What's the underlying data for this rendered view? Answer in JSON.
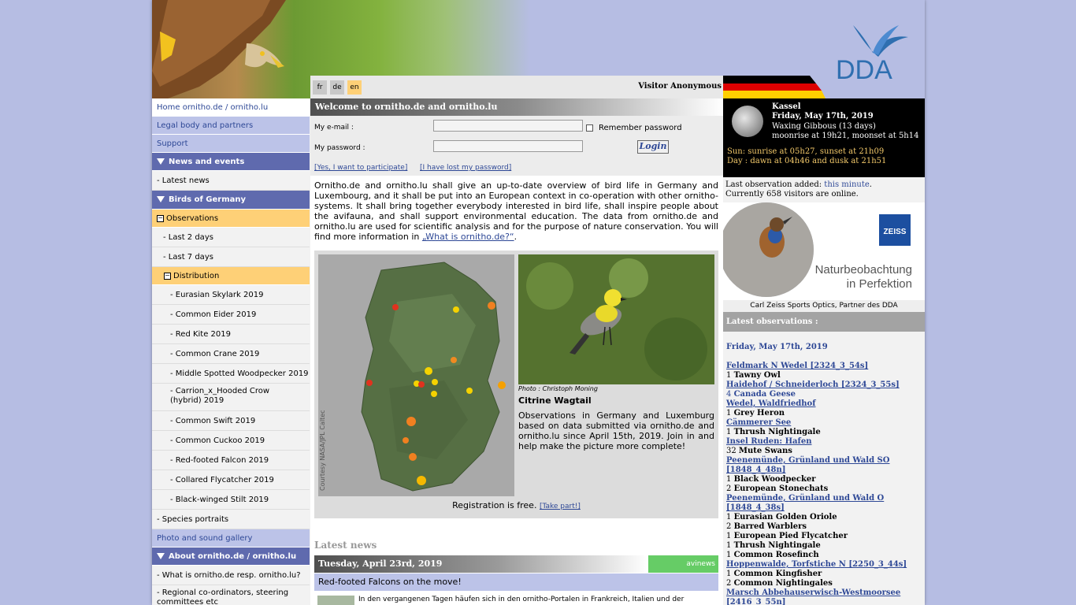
{
  "header": {
    "logo_text": "DDA",
    "languages": [
      {
        "code": "fr",
        "color": "#c8c8c8"
      },
      {
        "code": "de",
        "color": "#c8c8c8"
      },
      {
        "code": "en",
        "color": "#fed077"
      }
    ],
    "visitor": "Visitor Anonymous"
  },
  "sidebar": {
    "items": [
      {
        "label": "Home ornitho.de / ornitho.lu",
        "style": "white",
        "h": 23
      },
      {
        "label": "Legal body and partners",
        "style": "blue",
        "h": 23
      },
      {
        "label": "Support",
        "style": "blue",
        "h": 23
      },
      {
        "label": "News and events",
        "style": "head",
        "h": 23
      },
      {
        "label": "- Latest news",
        "style": "plain",
        "h": 25
      },
      {
        "label": "Birds of Germany",
        "style": "head",
        "h": 24
      },
      {
        "label": "Observations",
        "style": "orange",
        "h": 23
      },
      {
        "label": "- Last 2 days",
        "style": "plain",
        "h": 25
      },
      {
        "label": "- Last 7 days",
        "style": "plain",
        "h": 25
      },
      {
        "label": "Distribution",
        "style": "orange",
        "h": 23
      },
      {
        "label": "- Eurasian Skylark 2019",
        "style": "plain",
        "h": 25
      },
      {
        "label": "- Common Eider 2019",
        "style": "plain",
        "h": 25
      },
      {
        "label": "- Red Kite 2019",
        "style": "plain",
        "h": 25
      },
      {
        "label": "- Common Crane 2019",
        "style": "plain",
        "h": 25
      },
      {
        "label": "- Middle Spotted Woodpecker 2019",
        "style": "plain",
        "h": 25
      },
      {
        "label": "- Carrion_x_Hooded Crow (hybrid) 2019",
        "style": "plain",
        "h": 35
      },
      {
        "label": "- Common Swift 2019",
        "style": "plain",
        "h": 25
      },
      {
        "label": "- Common Cuckoo 2019",
        "style": "plain",
        "h": 25
      },
      {
        "label": "- Red-footed Falcon 2019",
        "style": "plain",
        "h": 25
      },
      {
        "label": "- Collared Flycatcher 2019",
        "style": "plain",
        "h": 25
      },
      {
        "label": "- Black-winged Stilt 2019",
        "style": "plain",
        "h": 25
      },
      {
        "label": "- Species portraits",
        "style": "plain",
        "h": 25
      },
      {
        "label": "Photo and sound gallery",
        "style": "blue",
        "h": 23
      },
      {
        "label": "About ornitho.de / ornitho.lu",
        "style": "head",
        "h": 23
      },
      {
        "label": "- What is ornitho.de resp. ornitho.lu?",
        "style": "plain",
        "h": 25
      },
      {
        "label": "- Regional co-ordinators, steering committees etc",
        "style": "plain",
        "h": 35
      }
    ]
  },
  "welcome": {
    "title": "Welcome to ornitho.de and ornitho.lu",
    "email_label": "My e-mail :",
    "password_label": "My password :",
    "remember_label": "Remember password",
    "login_button": "Login",
    "participate_link": "[Yes, I want to participate]",
    "lost_password_link": "[I have lost my password]"
  },
  "intro": {
    "p1": "Ornitho.de and ornitho.lu shall give an up-to-date overview of bird life in Germany and Luxembourg, and it shall be put into an European context in co-operation with other ornitho-systems. It shall bring together everybody interested in bird life, shall inspire people about the avifauna, and shall support environmental education. The data from ornitho.de and ornitho.lu are used for scientific analysis and for the purpose of nature conservation. You will find more information in ",
    "link": "„What is ornitho.de?“",
    "end": "."
  },
  "feature": {
    "map_credit": "Courtesy NASA/JPL Caltec",
    "photo_credit": "Photo : Christoph Moning",
    "species": "Citrine Wagtail",
    "text": "Observations in Germany and Luxemburg based on data submitted via ornitho.de and ornitho.lu since April 15th, 2019. Join in and help make the picture more complete!",
    "registration": "Registration is free.",
    "take_part": "[Take part!]"
  },
  "news": {
    "section_title": "Latest news",
    "date": "Tuesday, April 23rd, 2019",
    "source": "avinews",
    "headline": "Red-footed Falcons on the move!",
    "snippet": "In den vergangenen Tagen häufen sich in den ornitho-Portalen in Frankreich, Italien und der"
  },
  "astro": {
    "city": "Kassel",
    "date": "Friday, May 17th, 2019",
    "phase": "Waxing Gibbous (13 days)",
    "moon_times": "moonrise at 19h21, moonset at 5h14",
    "sun": "Sun: sunrise at 05h27, sunset at 21h09",
    "day": "Day : dawn at 04h46 and dusk at 21h51"
  },
  "visitors": {
    "last_obs_prefix": "Last observation added: ",
    "last_obs_link": "this minute",
    "last_obs_suffix": ".",
    "online": "Currently 658 visitors are online."
  },
  "ad": {
    "brand": "ZEISS",
    "slogan1": "Naturbeobachtung",
    "slogan2": "in Perfektion",
    "caption": "Carl Zeiss Sports Optics, Partner des DDA"
  },
  "latest_obs": {
    "header": "Latest observations :",
    "day": "Friday, May 17th, 2019",
    "entries": [
      {
        "loc": "Feldmark N Wedel [2324_3_54s]",
        "species": [
          {
            "n": "1",
            "name": "Tawny Owl"
          }
        ]
      },
      {
        "loc": "Haidehof / Schneiderloch [2324_3_55s]",
        "species": [
          {
            "n": "4",
            "name": "Canada Geese",
            "link": true
          }
        ]
      },
      {
        "loc": "Wedel, Waldfriedhof",
        "species": [
          {
            "n": "1",
            "name": "Grey Heron"
          }
        ]
      },
      {
        "loc": "Cämmerer See",
        "species": [
          {
            "n": "1",
            "name": "Thrush Nightingale"
          }
        ]
      },
      {
        "loc": "Insel Ruden: Hafen",
        "species": [
          {
            "n": "32",
            "name": "Mute Swans"
          }
        ]
      },
      {
        "loc": "Peenemünde, Grünland und Wald SO [1848_4_48n]",
        "species": [
          {
            "n": "1",
            "name": "Black Woodpecker"
          },
          {
            "n": "2",
            "name": "European Stonechats"
          }
        ]
      },
      {
        "loc": "Peenemünde, Grünland und Wald O [1848_4_38s]",
        "species": [
          {
            "n": "1",
            "name": "Eurasian Golden Oriole"
          },
          {
            "n": "2",
            "name": "Barred Warblers"
          },
          {
            "n": "1",
            "name": "European Pied Flycatcher"
          },
          {
            "n": "1",
            "name": "Thrush Nightingale"
          },
          {
            "n": "1",
            "name": "Common Rosefinch"
          }
        ]
      },
      {
        "loc": "Hoppenwalde, Torfstiche N [2250_3_44s]",
        "species": [
          {
            "n": "1",
            "name": "Common Kingfisher"
          },
          {
            "n": "2",
            "name": "Common Nightingales"
          }
        ]
      },
      {
        "loc": "Marsch Abbehauserwisch-Westmoorsee [2416_3_55n]",
        "species": []
      }
    ]
  }
}
